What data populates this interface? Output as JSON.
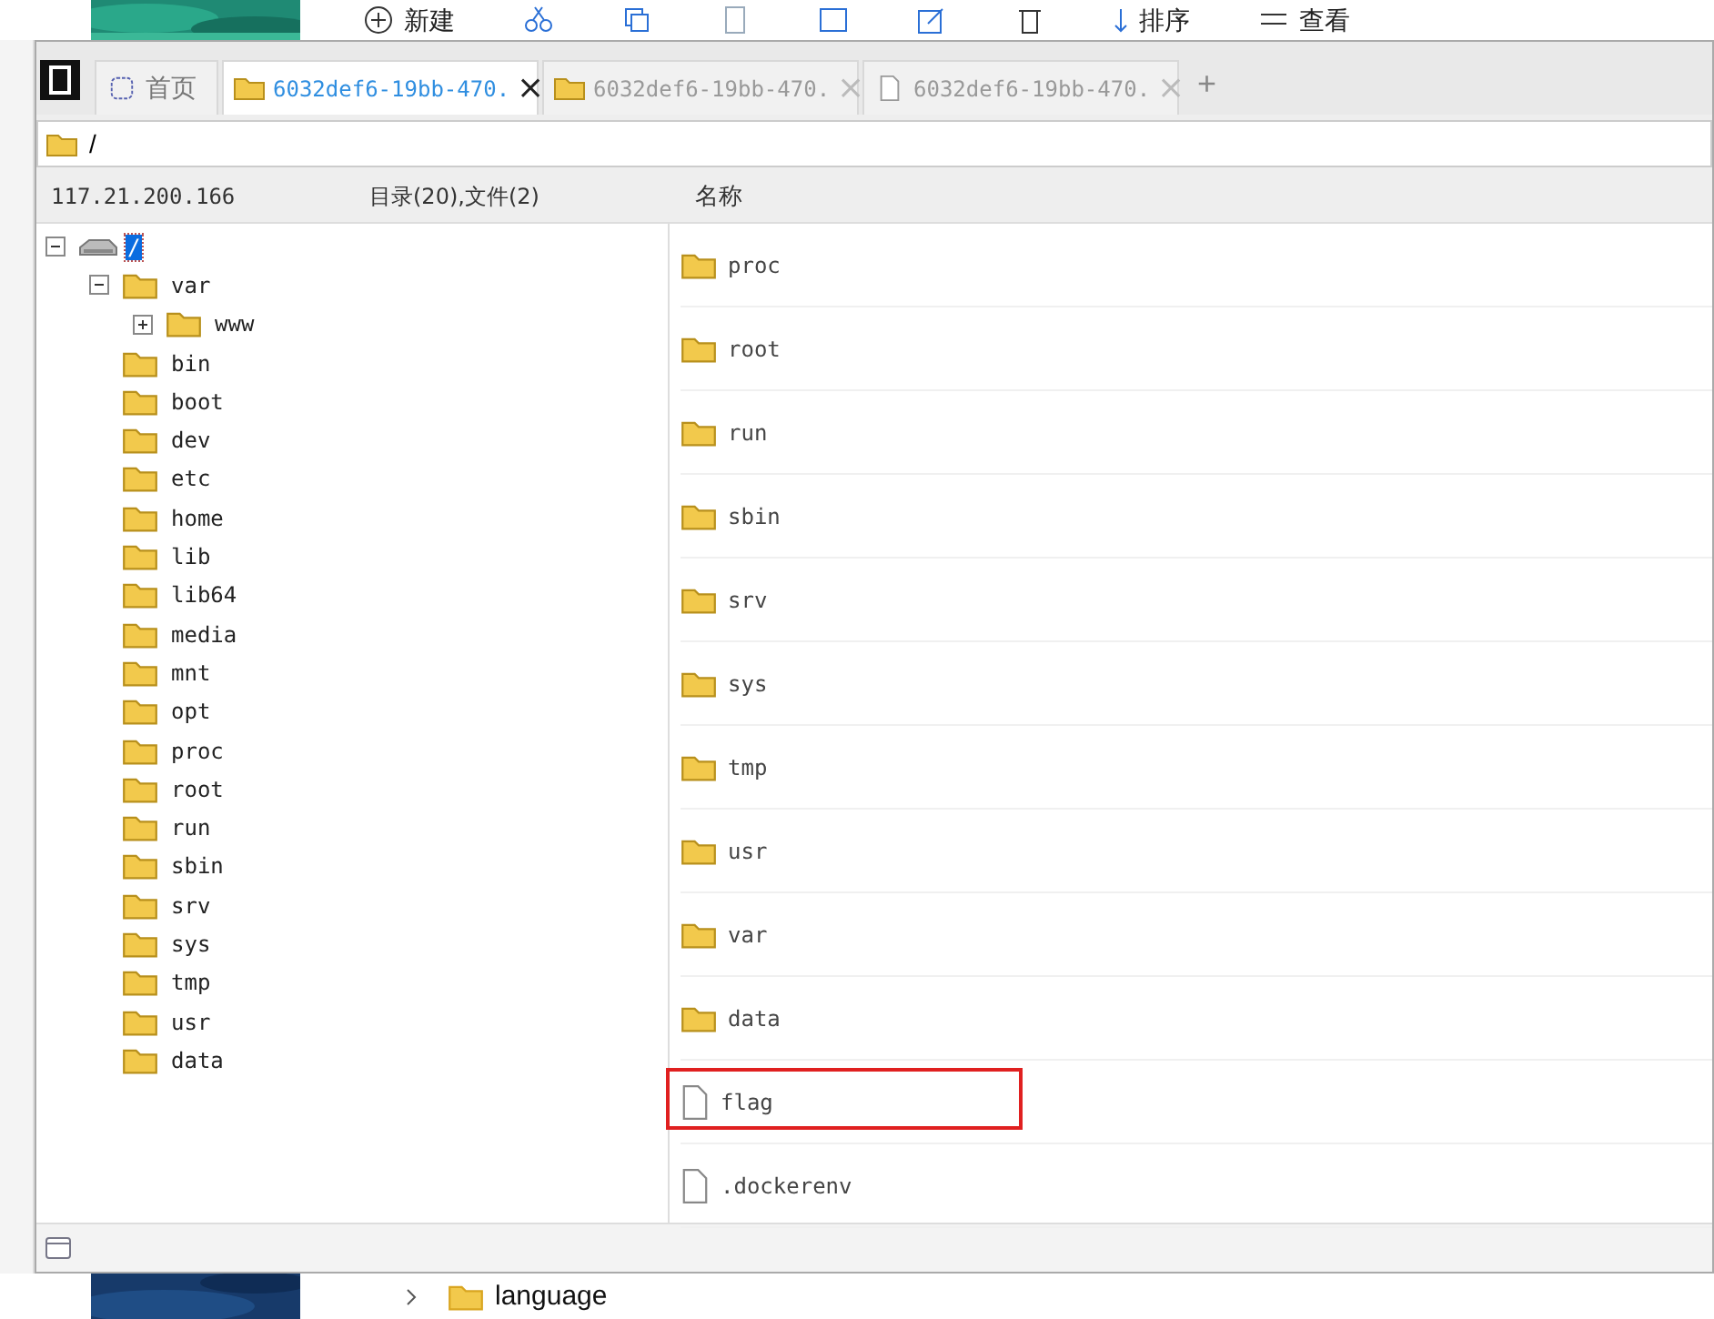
{
  "desktop": {
    "toolbar": [
      {
        "label": "新建",
        "kind": "new"
      },
      {
        "kind": "cut"
      },
      {
        "kind": "copy"
      },
      {
        "kind": "paste"
      },
      {
        "kind": "rename"
      },
      {
        "kind": "share"
      },
      {
        "kind": "delete"
      },
      {
        "label": "排序",
        "kind": "sort"
      },
      {
        "label": "查看",
        "kind": "view"
      }
    ],
    "folder": "language"
  },
  "tabs": [
    {
      "label": "首页",
      "kind": "home",
      "selected": false
    },
    {
      "label": "6032def6-19bb-470.",
      "kind": "folder",
      "selected": true,
      "close": "×"
    },
    {
      "label": "6032def6-19bb-470.",
      "kind": "folder",
      "selected": false,
      "close": "×"
    },
    {
      "label": "6032def6-19bb-470.",
      "kind": "file",
      "selected": false,
      "close": "×"
    }
  ],
  "new_tab": "+",
  "address": "/",
  "header": {
    "host": "117.21.200.166",
    "summary": "目录(20),文件(2)",
    "column_1": "名称"
  },
  "tree": [
    {
      "label": "/",
      "kind": "drive",
      "expanded": true,
      "selected": true,
      "children": [
        {
          "label": "var",
          "kind": "folder",
          "expanded": true,
          "children": [
            {
              "label": "www",
              "kind": "folder",
              "expanded": false
            }
          ]
        },
        {
          "label": "bin",
          "kind": "folder"
        },
        {
          "label": "boot",
          "kind": "folder"
        },
        {
          "label": "dev",
          "kind": "folder"
        },
        {
          "label": "etc",
          "kind": "folder"
        },
        {
          "label": "home",
          "kind": "folder"
        },
        {
          "label": "lib",
          "kind": "folder"
        },
        {
          "label": "lib64",
          "kind": "folder"
        },
        {
          "label": "media",
          "kind": "folder"
        },
        {
          "label": "mnt",
          "kind": "folder"
        },
        {
          "label": "opt",
          "kind": "folder"
        },
        {
          "label": "proc",
          "kind": "folder"
        },
        {
          "label": "root",
          "kind": "folder"
        },
        {
          "label": "run",
          "kind": "folder"
        },
        {
          "label": "sbin",
          "kind": "folder"
        },
        {
          "label": "srv",
          "kind": "folder"
        },
        {
          "label": "sys",
          "kind": "folder"
        },
        {
          "label": "tmp",
          "kind": "folder"
        },
        {
          "label": "usr",
          "kind": "folder"
        },
        {
          "label": "data",
          "kind": "folder"
        }
      ]
    }
  ],
  "files": [
    {
      "name": "proc",
      "kind": "folder",
      "highlighted": false
    },
    {
      "name": "root",
      "kind": "folder",
      "highlighted": false
    },
    {
      "name": "run",
      "kind": "folder",
      "highlighted": false
    },
    {
      "name": "sbin",
      "kind": "folder",
      "highlighted": false
    },
    {
      "name": "srv",
      "kind": "folder",
      "highlighted": false
    },
    {
      "name": "sys",
      "kind": "folder",
      "highlighted": false
    },
    {
      "name": "tmp",
      "kind": "folder",
      "highlighted": false
    },
    {
      "name": "usr",
      "kind": "folder",
      "highlighted": false
    },
    {
      "name": "var",
      "kind": "folder",
      "highlighted": false
    },
    {
      "name": "data",
      "kind": "folder",
      "highlighted": false
    },
    {
      "name": "flag",
      "kind": "file",
      "highlighted": true
    },
    {
      "name": ".dockerenv",
      "kind": "file",
      "highlighted": false
    }
  ]
}
